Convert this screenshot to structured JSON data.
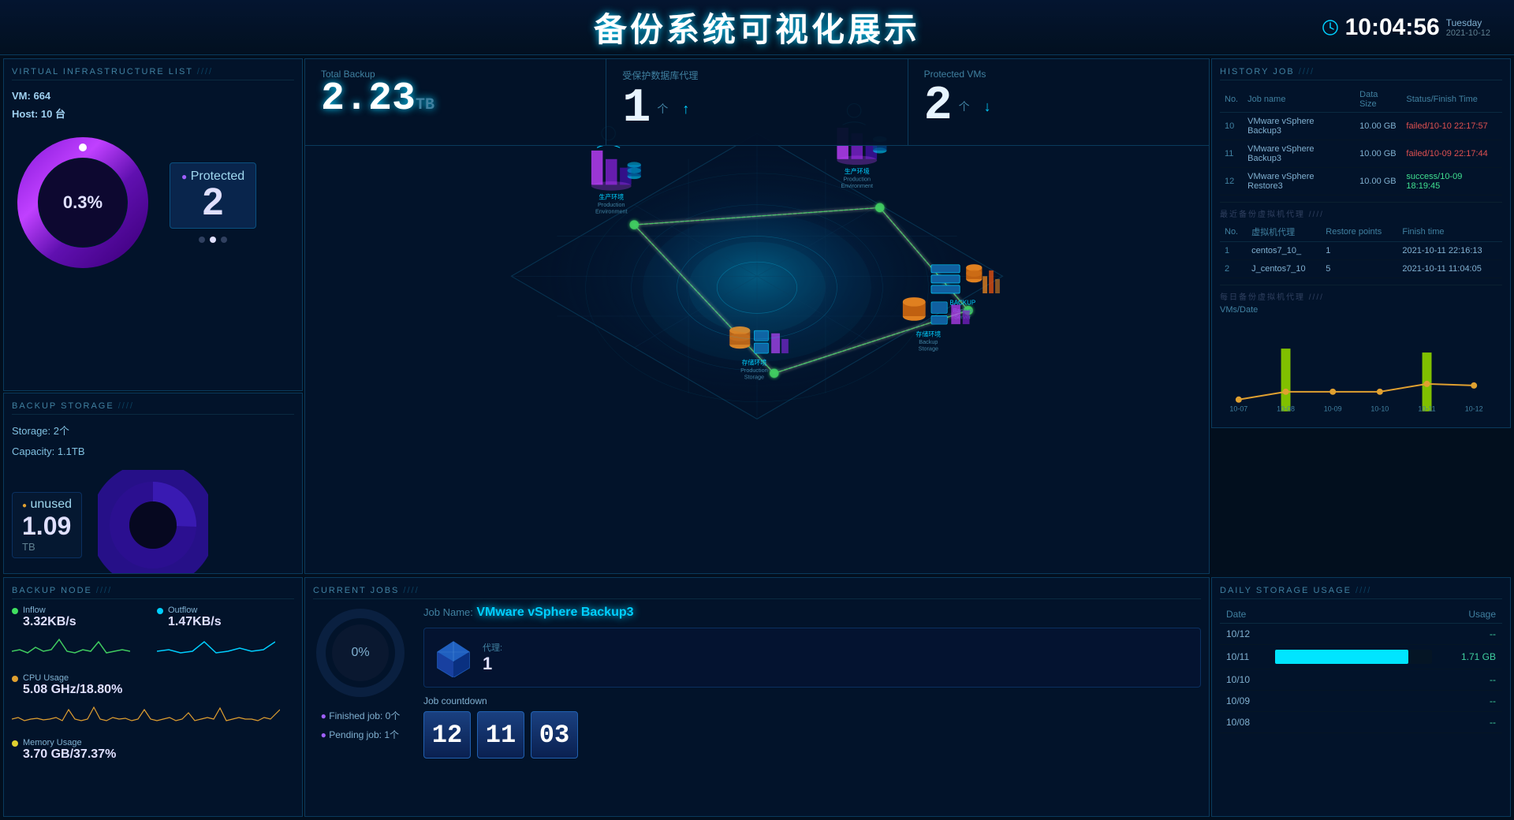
{
  "header": {
    "title": "备份系统可视化展示",
    "time": "10:04:56",
    "day": "Tuesday",
    "date": "2021-10-12",
    "clock_icon": "clock"
  },
  "virtual_infrastructure": {
    "panel_title": "VIRTUAL INFRASTRUCTURE LIST",
    "vm_count": "664",
    "host_count": "10",
    "vm_label": "VM:",
    "host_label": "Host:",
    "host_unit": "台",
    "percentage": "0.3%",
    "protected_label": "Protected",
    "protected_value": "2",
    "dot_count": 3,
    "active_dot": 1
  },
  "backup_storage": {
    "panel_title": "BACKUP STORAGE",
    "storage_count": "2个",
    "capacity": "1.1TB",
    "storage_label": "Storage:",
    "capacity_label": "Capacity:",
    "unused_label": "unused",
    "unused_value": "1.09",
    "unused_unit": "TB"
  },
  "top_stats": {
    "total_backup_label": "Total Backup",
    "total_backup_value": "2.23",
    "total_backup_unit": "TB",
    "db_proxy_label": "受保护数据库代理",
    "db_proxy_value": "1",
    "db_proxy_arrow": "↑",
    "protected_vms_label": "Protected VMs",
    "protected_vms_value": "2",
    "protected_vms_arrow": "↓"
  },
  "history_job": {
    "panel_title": "HISTORY JOB",
    "columns": [
      "No.",
      "Job name",
      "Data Size",
      "Status/Finish Time"
    ],
    "rows": [
      {
        "no": "10",
        "name": "VMware vSphere Backup3",
        "size": "10.00 GB",
        "status": "failed/10-10 22:17:57",
        "status_type": "failed"
      },
      {
        "no": "11",
        "name": "VMware vSphere Backup3",
        "size": "10.00 GB",
        "status": "failed/10-09 22:17:44",
        "status_type": "failed"
      },
      {
        "no": "12",
        "name": "VMware vSphere Restore3",
        "size": "10.00 GB",
        "status": "success/10-09 18:19:45",
        "status_type": "success"
      }
    ]
  },
  "recent_vm_proxy": {
    "section_title": "最近备份虚拟机代理",
    "columns": [
      "No.",
      "虚拟机代理",
      "Restore points",
      "Finish time"
    ],
    "rows": [
      {
        "no": "1",
        "name": "centos7_10_",
        "points": "1",
        "time": "2021-10-11 22:16:13"
      },
      {
        "no": "2",
        "name": "J_centos7_10",
        "points": "5",
        "time": "2021-10-11 11:04:05"
      }
    ]
  },
  "daily_vm_chart": {
    "section_title": "每日备份虚拟机代理",
    "y_label": "VMs/Date",
    "dates": [
      "10-07",
      "10-08",
      "10-09",
      "10-10",
      "10-11",
      "10-12"
    ],
    "series1_color": "#80c000",
    "series2_color": "#e0a030",
    "series1_values": [
      0,
      8,
      0,
      0,
      6,
      0
    ],
    "series2_values": [
      1,
      2,
      2,
      2,
      3,
      3
    ]
  },
  "backup_node": {
    "panel_title": "BACKUP NODE",
    "inflow_label": "Inflow",
    "inflow_value": "3.32KB/s",
    "outflow_label": "Outflow",
    "outflow_value": "1.47KB/s",
    "cpu_label": "CPU Usage",
    "cpu_value": "5.08 GHz/18.80%",
    "memory_label": "Memory Usage",
    "memory_value": "3.70 GB/37.37%"
  },
  "current_jobs": {
    "panel_title": "CURRENT JOBS",
    "progress": "0%",
    "finished_label": "Finished job:",
    "finished_value": "0个",
    "pending_label": "Pending job:",
    "pending_value": "1个",
    "job_name_label": "Job Name:",
    "job_name": "VMware vSphere Backup3",
    "proxy_label": "代理:",
    "proxy_value": "1",
    "countdown_label": "Job countdown",
    "countdown_h": "12",
    "countdown_m": "11",
    "countdown_s": "03"
  },
  "daily_storage": {
    "panel_title": "DAILY STORAGE USAGE",
    "col_date": "Date",
    "col_usage": "Usage",
    "rows": [
      {
        "date": "10/12",
        "usage": "--",
        "bar": 0
      },
      {
        "date": "10/11",
        "usage": "1.71 GB",
        "bar": 85
      },
      {
        "date": "10/10",
        "usage": "--",
        "bar": 0
      },
      {
        "date": "10/09",
        "usage": "--",
        "bar": 0
      },
      {
        "date": "10/08",
        "usage": "--",
        "bar": 0
      }
    ]
  },
  "map": {
    "center_label": "生产环境",
    "node1_label": "生产环境\nProduction\nEnvironment",
    "node2_label": "存储环境\nBackup\nStorage",
    "node3_label": "存储环境\nProduction\nStorage",
    "node4_label": "Backup\nServer"
  }
}
